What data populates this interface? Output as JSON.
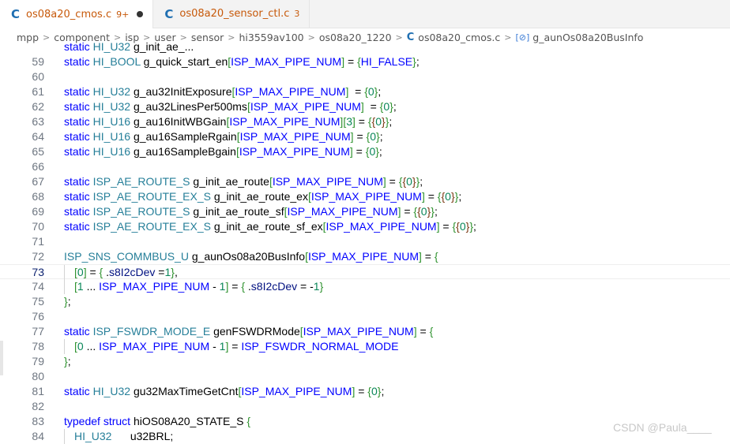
{
  "tabs": [
    {
      "icon": "C",
      "name": "os08a20_cmos.c",
      "badge": "9+",
      "active": true,
      "dirty": true
    },
    {
      "icon": "C",
      "name": "os08a20_sensor_ctl.c",
      "badge": "3",
      "active": false,
      "dirty": false
    }
  ],
  "breadcrumb": {
    "parts": [
      "mpp",
      "component",
      "isp",
      "user",
      "sensor",
      "hi3559av100",
      "os08a20_1220"
    ],
    "file_icon": "C",
    "file": "os08a20_cmos.c",
    "symbol_icon": "[⊘]",
    "symbol": "g_aunOs08a20BusInfo"
  },
  "lines": [
    {
      "n": "59",
      "t": "static HI_BOOL g_quick_start_en[ISP_MAX_PIPE_NUM] = {HI_FALSE};"
    },
    {
      "n": "60",
      "t": ""
    },
    {
      "n": "61",
      "t": "static HI_U32 g_au32InitExposure[ISP_MAX_PIPE_NUM]  = {0};"
    },
    {
      "n": "62",
      "t": "static HI_U32 g_au32LinesPer500ms[ISP_MAX_PIPE_NUM]  = {0};"
    },
    {
      "n": "63",
      "t": "static HI_U16 g_au16InitWBGain[ISP_MAX_PIPE_NUM][3] = {{0}};"
    },
    {
      "n": "64",
      "t": "static HI_U16 g_au16SampleRgain[ISP_MAX_PIPE_NUM] = {0};"
    },
    {
      "n": "65",
      "t": "static HI_U16 g_au16SampleBgain[ISP_MAX_PIPE_NUM] = {0};"
    },
    {
      "n": "66",
      "t": ""
    },
    {
      "n": "67",
      "t": "static ISP_AE_ROUTE_S g_init_ae_route[ISP_MAX_PIPE_NUM] = {{0}};"
    },
    {
      "n": "68",
      "t": "static ISP_AE_ROUTE_EX_S g_init_ae_route_ex[ISP_MAX_PIPE_NUM] = {{0}};"
    },
    {
      "n": "69",
      "t": "static ISP_AE_ROUTE_S g_init_ae_route_sf[ISP_MAX_PIPE_NUM] = {{0}};"
    },
    {
      "n": "70",
      "t": "static ISP_AE_ROUTE_EX_S g_init_ae_route_sf_ex[ISP_MAX_PIPE_NUM] = {{0}};"
    },
    {
      "n": "71",
      "t": ""
    },
    {
      "n": "72",
      "t": "ISP_SNS_COMMBUS_U g_aunOs08a20BusInfo[ISP_MAX_PIPE_NUM] = {"
    },
    {
      "n": "73",
      "t": "[0] = { .s8I2cDev =1},"
    },
    {
      "n": "74",
      "t": "[1 ... ISP_MAX_PIPE_NUM - 1] = { .s8I2cDev = -1}"
    },
    {
      "n": "75",
      "t": "};"
    },
    {
      "n": "76",
      "t": ""
    },
    {
      "n": "77",
      "t": "static ISP_FSWDR_MODE_E genFSWDRMode[ISP_MAX_PIPE_NUM] = {"
    },
    {
      "n": "78",
      "t": "[0 ... ISP_MAX_PIPE_NUM - 1] = ISP_FSWDR_NORMAL_MODE"
    },
    {
      "n": "79",
      "t": "};"
    },
    {
      "n": "80",
      "t": ""
    },
    {
      "n": "81",
      "t": "static HI_U32 gu32MaxTimeGetCnt[ISP_MAX_PIPE_NUM] = {0};"
    },
    {
      "n": "82",
      "t": ""
    },
    {
      "n": "83",
      "t": "typedef struct hiOS08A20_STATE_S {"
    },
    {
      "n": "84",
      "t": "HI_U32      u32BRL;"
    }
  ],
  "partial_top_line": "static HI_U32 g_init_ae_...",
  "active_line": "73",
  "watermark": "CSDN @Paula____"
}
